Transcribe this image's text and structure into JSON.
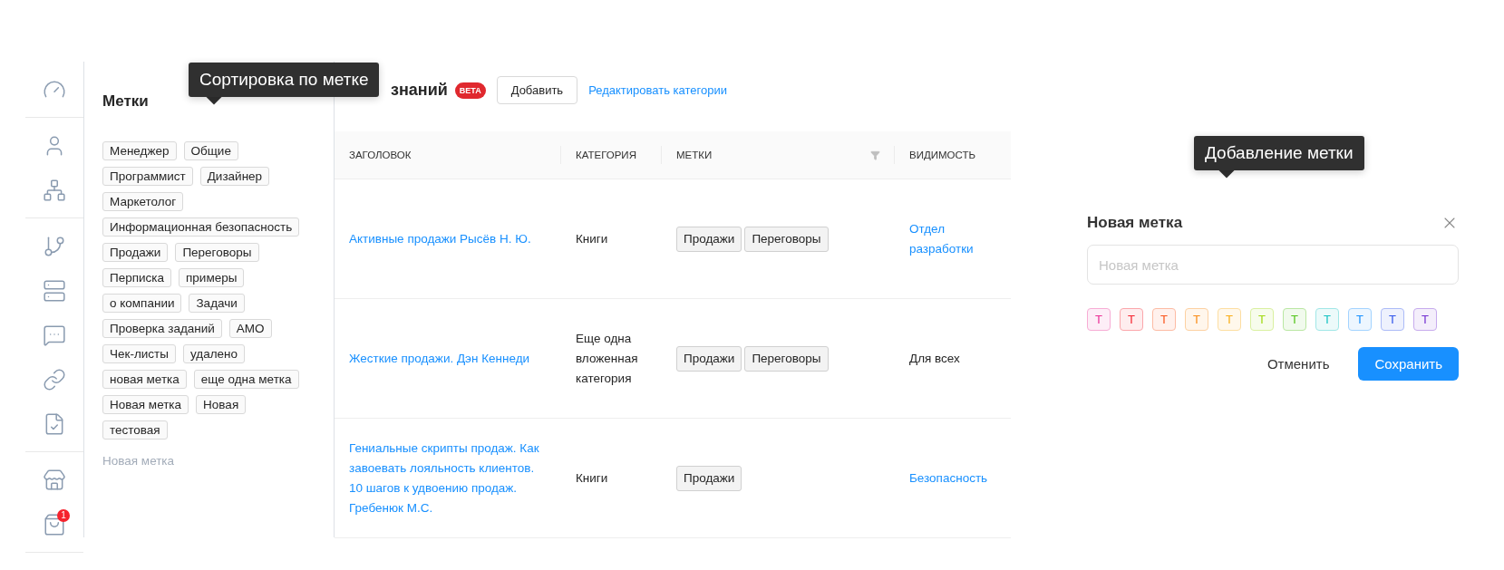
{
  "sidebar": {
    "groups": [
      {
        "items": [
          {
            "kind": "gauge"
          }
        ]
      },
      {
        "items": [
          {
            "kind": "user"
          },
          {
            "kind": "structure"
          }
        ]
      },
      {
        "items": [
          {
            "kind": "branch"
          },
          {
            "kind": "server"
          },
          {
            "kind": "chat"
          },
          {
            "kind": "link"
          },
          {
            "kind": "doc-check"
          }
        ]
      },
      {
        "items": [
          {
            "kind": "store"
          },
          {
            "kind": "bag",
            "badge": "1"
          }
        ]
      }
    ]
  },
  "labels_panel": {
    "title": "Метки",
    "labels": [
      "Менеджер",
      "Общие",
      "Программист",
      "Дизайнер",
      "Маркетолог",
      "Информационная безопасность",
      "Продажи",
      "Переговоры",
      "Перписка",
      "примеры",
      "о компании",
      "Задачи",
      "Проверка заданий",
      "АМО",
      "Чек-листы",
      "удалено",
      "новая метка",
      "еще одна метка",
      "Новая метка",
      "Новая",
      "тестовая"
    ],
    "add_label": "Новая метка"
  },
  "sort_tooltip": "Сортировка по метке",
  "header": {
    "title": "знаний",
    "badge": "BETA",
    "add_button": "Добавить",
    "edit_link": "Редактировать категории"
  },
  "table": {
    "columns": [
      {
        "label": "ЗАГОЛОВОК"
      },
      {
        "label": "КАТЕГОРИЯ"
      },
      {
        "label": "МЕТКИ",
        "filter": true
      },
      {
        "label": "ВИДИМОСТЬ"
      }
    ],
    "rows": [
      {
        "title": "Активные продажи Рысёв Н. Ю.",
        "category": "Книги",
        "tags": [
          "Продажи",
          "Переговоры"
        ],
        "visibility": "Отдел разработки",
        "visibility_link": true
      },
      {
        "title": "Жесткие продажи. Дэн Кеннеди",
        "category": "Еще одна вложенная категория",
        "tags": [
          "Продажи",
          "Переговоры"
        ],
        "visibility": "Для всех",
        "visibility_link": false
      },
      {
        "title": "Гениальные скрипты продаж. Как завоевать лояльность клиентов. 10 шагов к удвоению продаж. Гребенюк М.С.",
        "category": "Книги",
        "tags": [
          "Продажи"
        ],
        "visibility": "Безопасность",
        "visibility_link": true
      }
    ]
  },
  "add_tooltip": "Добавление метки",
  "new_label_dialog": {
    "title": "Новая метка",
    "placeholder": "Новая метка",
    "colors": [
      {
        "label": "T",
        "color": "#eb2f96"
      },
      {
        "label": "T",
        "color": "#f5222d"
      },
      {
        "label": "T",
        "color": "#fa541c"
      },
      {
        "label": "T",
        "color": "#fa8c16"
      },
      {
        "label": "T",
        "color": "#faad14"
      },
      {
        "label": "T",
        "color": "#a0d911"
      },
      {
        "label": "T",
        "color": "#52c41a"
      },
      {
        "label": "T",
        "color": "#13c2c2"
      },
      {
        "label": "T",
        "color": "#1890ff"
      },
      {
        "label": "T",
        "color": "#2f54eb"
      },
      {
        "label": "T",
        "color": "#722ed1"
      }
    ],
    "cancel": "Отменить",
    "save": "Сохранить"
  }
}
